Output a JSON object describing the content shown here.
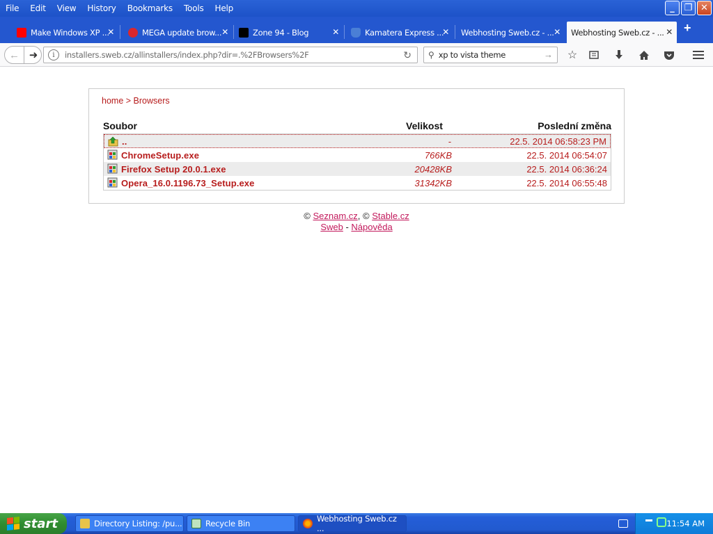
{
  "menubar": {
    "items": [
      "File",
      "Edit",
      "View",
      "History",
      "Bookmarks",
      "Tools",
      "Help"
    ]
  },
  "window_controls": {
    "minimize": "_",
    "maximize": "❐",
    "close": "✕"
  },
  "tabs": [
    {
      "title": "Make Windows XP ...",
      "icon": "youtube-icon",
      "color": "#ff0000"
    },
    {
      "title": "MEGA update brow...",
      "icon": "mega-icon",
      "color": "#d9272e"
    },
    {
      "title": "Zone 94 - Blog",
      "icon": "zone94-icon",
      "color": "#000000"
    },
    {
      "title": "Kamatera Express ...",
      "icon": "kamatera-icon",
      "color": "#4a7fd6"
    },
    {
      "title": "Webhosting Sweb.cz - ...",
      "icon": "none",
      "color": ""
    },
    {
      "title": "Webhosting Sweb.cz - ...",
      "icon": "none",
      "color": "",
      "active": true
    }
  ],
  "new_tab": "+",
  "navbar": {
    "url": "installers.sweb.cz/allinstallers/index.php?dir=.%2FBrowsers%2F",
    "search_value": "xp to vista theme"
  },
  "page": {
    "breadcrumb": "home > Browsers",
    "columns": {
      "name": "Soubor",
      "size": "Velikost",
      "modified": "Poslední změna"
    },
    "files": [
      {
        "name": "..",
        "size": "-",
        "date": "22.5. 2014 06:58:23 PM",
        "icon": "up-folder-icon"
      },
      {
        "name": "ChromeSetup.exe",
        "size": "766KB",
        "date": "22.5. 2014 06:54:07",
        "icon": "exe-file-icon"
      },
      {
        "name": "Firefox Setup 20.0.1.exe",
        "size": "20428KB",
        "date": "22.5. 2014 06:36:24",
        "icon": "exe-file-icon"
      },
      {
        "name": "Opera_16.0.1196.73_Setup.exe",
        "size": "31342KB",
        "date": "22.5. 2014 06:55:48",
        "icon": "exe-file-icon"
      }
    ],
    "footer": {
      "copy1": "©",
      "link1": "Seznam.cz",
      "sep": ", ©",
      "link2": "Stable.cz",
      "link3": "Sweb",
      "dash": " - ",
      "link4": "Nápověda"
    }
  },
  "taskbar": {
    "start_label": "start",
    "tasks": [
      {
        "title": "Directory Listing: /pu...",
        "icon": "folder-icon"
      },
      {
        "title": "Recycle Bin",
        "icon": "recycle-bin-icon"
      },
      {
        "title": "Webhosting Sweb.cz ...",
        "icon": "firefox-icon",
        "active": true
      }
    ],
    "clock": "11:54 AM"
  },
  "colors": {
    "link_red": "#b71c1c",
    "footer_link": "#c2185b",
    "xp_blue": "#245ed8",
    "start_green": "#2f8d2f"
  }
}
